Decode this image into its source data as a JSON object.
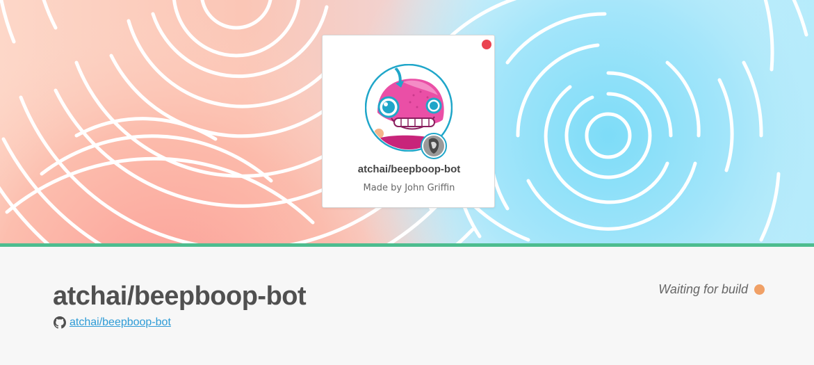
{
  "card": {
    "title": "atchai/beepboop-bot",
    "subtitle": "Made by John Griffin",
    "status_color": "#ea4350"
  },
  "repo": {
    "title": "atchai/beepboop-bot",
    "link_text": "atchai/beepboop-bot",
    "link_icon": "github-icon"
  },
  "build": {
    "status_text": "Waiting for build",
    "status_color": "#f0a066"
  },
  "colors": {
    "accent_divider": "#4dbd8f",
    "link": "#2d9bd6"
  }
}
